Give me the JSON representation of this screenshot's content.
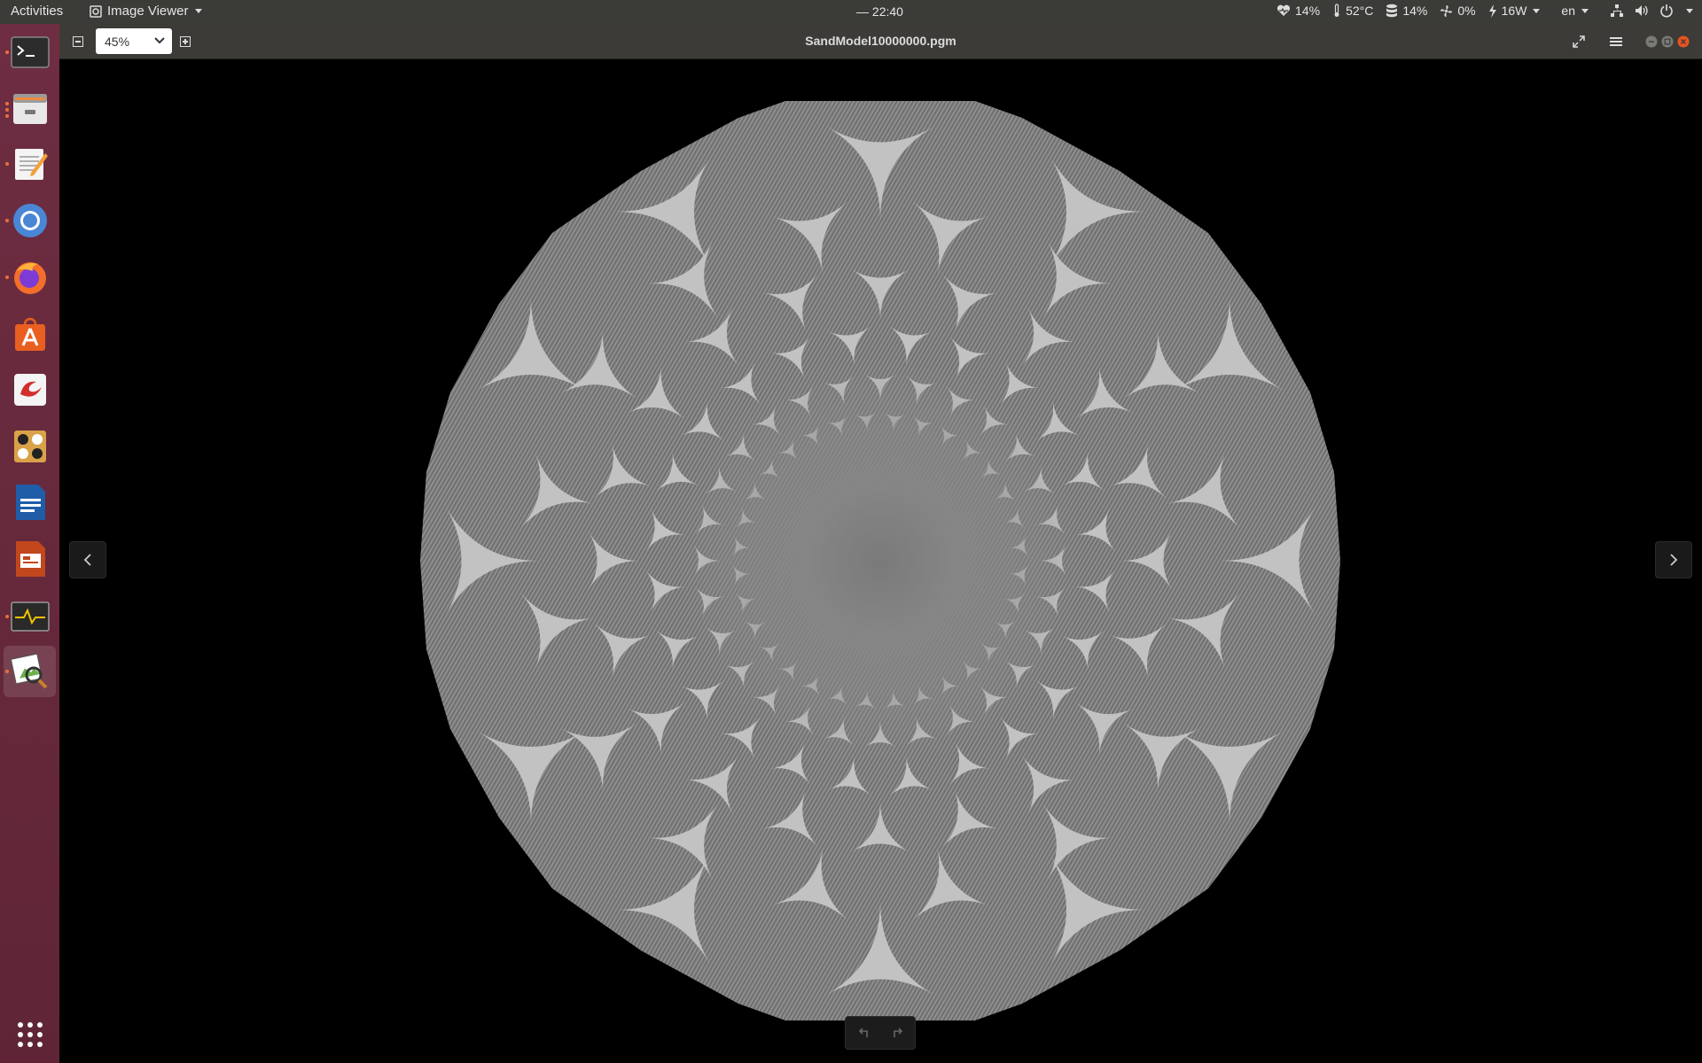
{
  "topbar": {
    "activities": "Activities",
    "app_name": "Image Viewer",
    "clock": "— 22:40",
    "tray": {
      "cpu": "14%",
      "temp": "52°C",
      "disk": "14%",
      "fan": "0%",
      "power": "16W",
      "lang": "en"
    }
  },
  "window": {
    "title": "SandModel10000000.pgm",
    "zoom": "45%"
  },
  "dock": {
    "items": [
      "terminal-icon",
      "files-icon",
      "text-editor-icon",
      "chromium-icon",
      "firefox-icon",
      "software-center-icon",
      "pdf-viewer-icon",
      "board-game-icon",
      "writer-icon",
      "impress-icon",
      "system-monitor-icon",
      "image-viewer-icon",
      "show-apps-icon"
    ]
  },
  "image": {
    "kind": "sandpile fractal",
    "colors": {
      "light": "#c0c0c0",
      "mid": "#8d8d8d",
      "dark": "#666666"
    }
  }
}
